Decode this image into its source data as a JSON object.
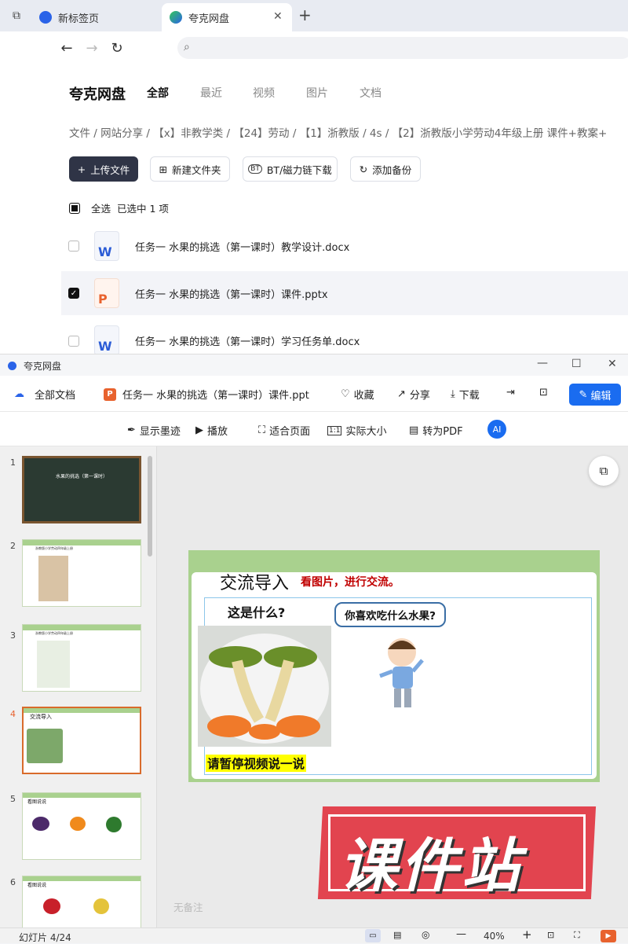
{
  "tabs": [
    {
      "label": "新标签页"
    },
    {
      "label": "夸克网盘"
    }
  ],
  "header": {
    "app_title": "夸克网盘",
    "categories": [
      "全部",
      "最近",
      "视频",
      "图片",
      "文档"
    ]
  },
  "breadcrumb": "文件 / 网站分享 / 【x】非教学类 / 【24】劳动 / 【1】浙教版 / 4s / 【2】浙教版小学劳动4年级上册 课件+教案+",
  "actions": {
    "upload": "上传文件",
    "new_folder": "新建文件夹",
    "bt": "BT/磁力链下载",
    "backup": "添加备份"
  },
  "selection": {
    "select_all": "全选",
    "selected_text": "已选中 1 项"
  },
  "files": [
    {
      "name": "任务一 水果的挑选（第一课时）教学设计.docx",
      "type": "W",
      "checked": false
    },
    {
      "name": "任务一 水果的挑选（第一课时）课件.pptx",
      "type": "P",
      "checked": true
    },
    {
      "name": "任务一 水果的挑选（第一课时）学习任务单.docx",
      "type": "W",
      "checked": false
    }
  ],
  "viewer": {
    "window_title": "夸克网盘",
    "all_docs": "全部文档",
    "file_name": "任务一 水果的挑选（第一课时）课件.ppt",
    "favorite": "收藏",
    "share": "分享",
    "download": "下载",
    "edit": "编辑",
    "tools": [
      "显示墨迹",
      "播放",
      "适合页面",
      "实际大小",
      "转为PDF"
    ],
    "no_notes": "无备注",
    "status": "幻灯片 4/24",
    "zoom": "40%"
  },
  "thumbnails": [
    {
      "num": "1",
      "title": "水果的挑选（第一课时）"
    },
    {
      "num": "2",
      "title": "浙教版小学劳动四年级上册"
    },
    {
      "num": "3",
      "title": "浙教版小学劳动四年级上册"
    },
    {
      "num": "4",
      "title": "交流导入"
    },
    {
      "num": "5",
      "title": "看图说说"
    },
    {
      "num": "6",
      "title": "看图说说"
    }
  ],
  "slide": {
    "title": "交流导入",
    "subtitle": "看图片，进行交流。",
    "question1": "这是什么?",
    "question2": "你喜欢吃什么水果?",
    "banner": "请暂停视频说一说"
  },
  "watermark": "课件站",
  "colors": {
    "primary_button": "#2f3446",
    "edit_button": "#1a6cf0",
    "slide_green": "#a9d18e",
    "slide_red": "#c00000"
  }
}
